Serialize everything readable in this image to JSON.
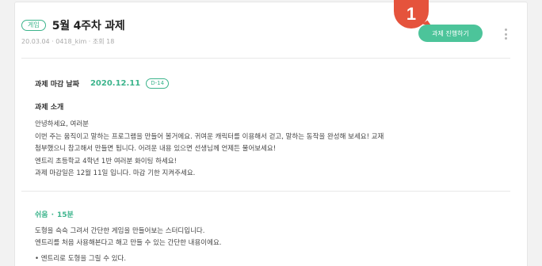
{
  "header": {
    "badge": "게임",
    "title": "5월 4주차 과제",
    "meta": "20.03.04 · 0418_kim · 조회 18",
    "step_number": "1",
    "progress_button": "과제 진행하기"
  },
  "due": {
    "label": "과제 마감 날짜",
    "date": "2020.12.11",
    "dday": "D-14"
  },
  "intro": {
    "heading": "과제 소개",
    "lines": [
      "안녕하세요, 여러분",
      "이번 주는 움직이고 말하는 프로그램을 만들어 볼거에요. 귀여운 캐릭터를 이용해서 걷고, 말하는 동작을 완성해 보세요! 교재",
      "첨부했으니 참고해서 만들면 됩니다. 어려운 내용 있으면 선생님께 언제든 물어보세요!",
      "엔트리 초등학교 4학년 1반 여러분 화이팅 하세요!",
      "과제 마감일은 12월 11일 입니다. 마감 기한 지켜주세요."
    ]
  },
  "level": {
    "difficulty": "쉬움",
    "separator": "·",
    "duration": "15분",
    "lines": [
      "도형을 슥슥 그려서 간단한 게임을 만들어보는 스터디입니다.",
      "엔트리를 처음 사용해본다고 해고 만들 수 있는 간단한 내용이에요."
    ],
    "bullet": "• 엔트리로 도형을 그릴 수 있다."
  },
  "colors": {
    "accent": "#3cb48c",
    "button": "#4cc49a",
    "marker": "#e5533c"
  },
  "icons": {
    "more": "more-vertical-icon"
  }
}
